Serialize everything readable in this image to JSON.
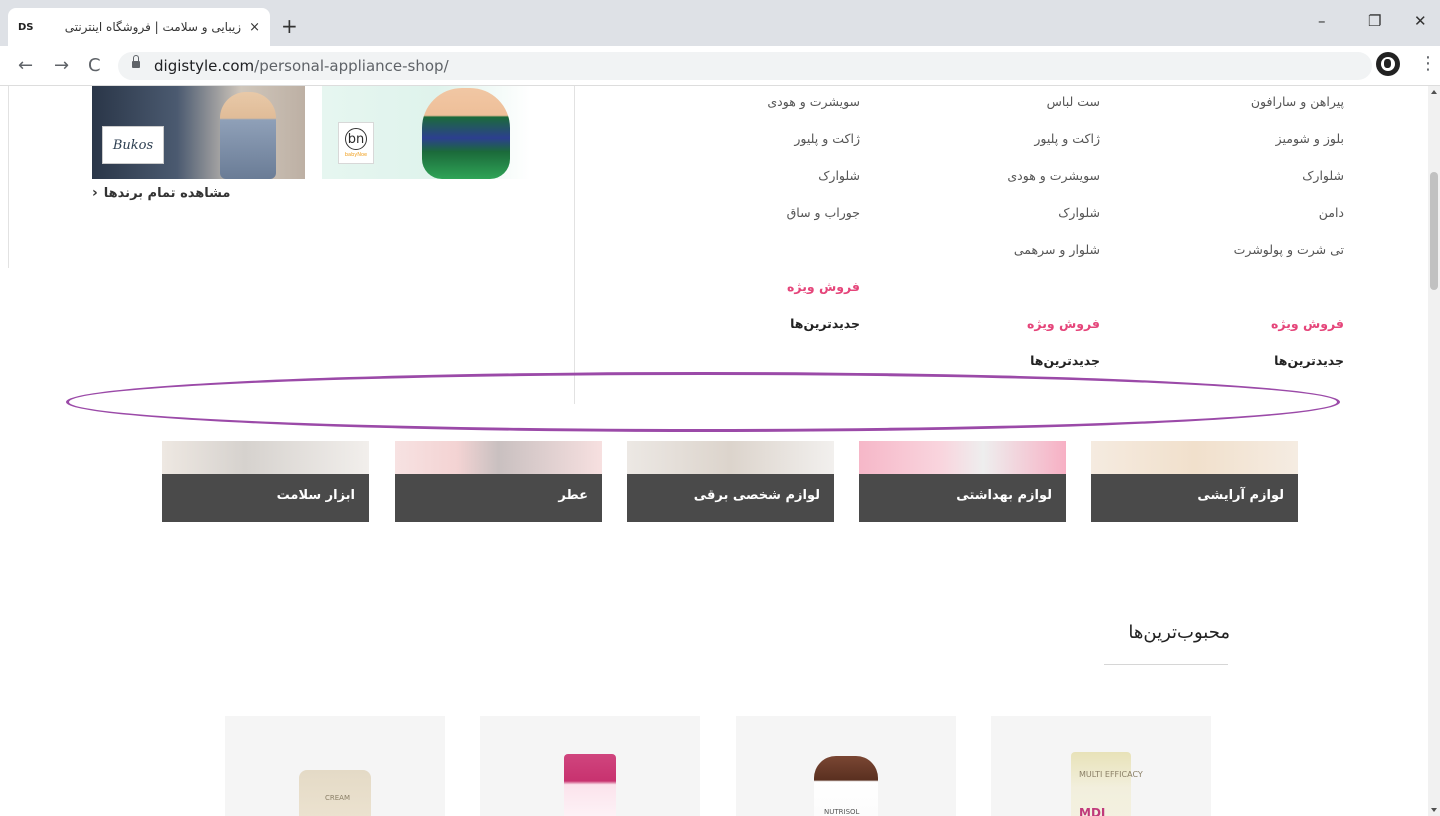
{
  "browser": {
    "tab": {
      "favicon": "DS",
      "title": "زیبایی و سلامت | فروشگاه اینترنتی",
      "close_icon": "×"
    },
    "new_tab_icon": "+",
    "window_controls": {
      "minimize": "–",
      "restore": "❐",
      "close": "✕"
    },
    "nav": {
      "back": "←",
      "forward": "→",
      "reload": "C"
    },
    "url": {
      "host": "digistyle.com",
      "path": "/personal-appliance-shop/"
    },
    "star_icon": "☆",
    "menu_icon": "⋮"
  },
  "megamenu": {
    "brands_link": "مشاهده تمام برندها",
    "brands_chevron": "‹",
    "brand_logos": {
      "bukos": "Bukos",
      "bn": "bn",
      "bn_sub": "babyNoe"
    },
    "columns": [
      {
        "items": [
          "پیراهن و سارافون",
          "بلوز و شومیز",
          "شلوارک",
          "دامن",
          "تی شرت و پولوشرت"
        ],
        "sale": "فروش ویژه",
        "newest": "جدیدترین‌ها"
      },
      {
        "items": [
          "ست لباس",
          "ژاکت و پلیور",
          "سویشرت و هودی",
          "شلوارک",
          "شلوار و سرهمی"
        ],
        "sale": "فروش ویژه",
        "newest": "جدیدترین‌ها"
      },
      {
        "items": [
          "سویشرت و هودی",
          "ژاکت و پلیور",
          "شلوارک",
          "جوراب و ساق"
        ],
        "sale": "فروش ویژه",
        "newest": "جدیدترین‌ها"
      }
    ]
  },
  "categories": [
    {
      "label": "لوازم آرایشی"
    },
    {
      "label": "لوازم بهداشتی"
    },
    {
      "label": "لوازم شخصی برقی"
    },
    {
      "label": "عطر"
    },
    {
      "label": "ابزار سلامت"
    }
  ],
  "section": {
    "title": "محبوب‌ترین‌ها"
  },
  "products": [
    {
      "label_lines": "MULTI EFFICACY",
      "brand": "MDI"
    },
    {
      "brand": "NUTRISOL"
    },
    {
      "brand": ""
    },
    {
      "brand": "CREAM"
    }
  ],
  "colors": {
    "sale": "#e5457a",
    "category_bar": "#4a4a4a",
    "highlight": "#9b4aa8"
  }
}
